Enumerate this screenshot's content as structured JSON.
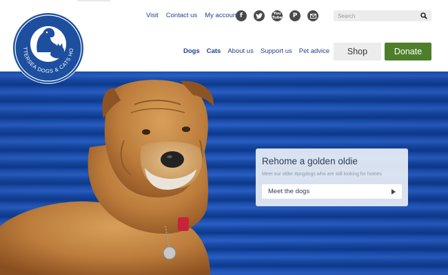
{
  "logo": {
    "text": "BATTERSEA DOGS & CATS HOME"
  },
  "utility_nav": [
    "Visit",
    "Contact us",
    "My account"
  ],
  "social": [
    {
      "icon": "facebook-icon",
      "glyph": "f"
    },
    {
      "icon": "twitter-icon",
      "glyph": ""
    },
    {
      "icon": "youtube-icon",
      "glyph": "You Tube"
    },
    {
      "icon": "pinterest-icon",
      "glyph": "P"
    },
    {
      "icon": "email-icon",
      "glyph": ""
    }
  ],
  "search": {
    "placeholder": "Search"
  },
  "main_nav": [
    "Dogs",
    "Cats",
    "About us",
    "Support us",
    "Pet advice"
  ],
  "buttons": {
    "shop": "Shop",
    "donate": "Donate"
  },
  "hero": {
    "title": "Rehome a golden oldie",
    "subtitle": "Meet our older #pogdogs who are still looking for homes",
    "cta": "Meet the dogs"
  },
  "colors": {
    "brand_blue": "#1d3f8f",
    "donate_green": "#4d7f2a",
    "hero_blue": "#1b4fb0",
    "icon_grey": "#4a4a4a"
  }
}
